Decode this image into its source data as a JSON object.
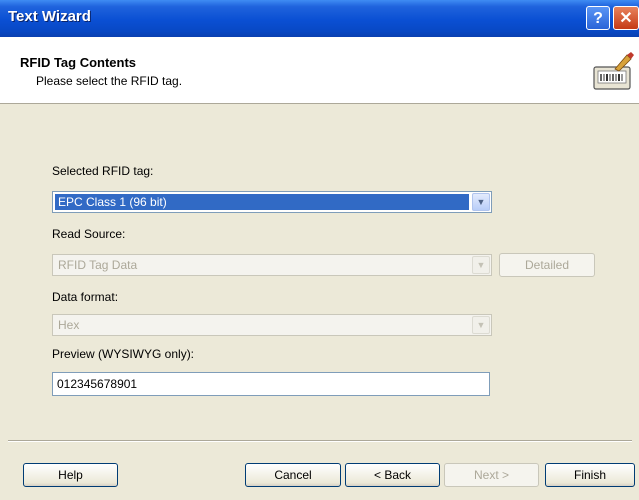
{
  "window": {
    "title": "Text Wizard"
  },
  "header": {
    "title": "RFID Tag Contents",
    "subtitle": "Please select the RFID tag."
  },
  "form": {
    "selected_tag": {
      "label": "Selected RFID tag:",
      "value": "EPC Class 1 (96 bit)"
    },
    "read_source": {
      "label": "Read Source:",
      "value": "RFID Tag Data",
      "detailed_label": "Detailed"
    },
    "data_format": {
      "label": "Data format:",
      "value": "Hex"
    },
    "preview": {
      "label": "Preview (WYSIWYG only):",
      "value": "012345678901"
    }
  },
  "buttons": {
    "help": "Help",
    "cancel": "Cancel",
    "back": "< Back",
    "next": "Next >",
    "finish": "Finish"
  }
}
